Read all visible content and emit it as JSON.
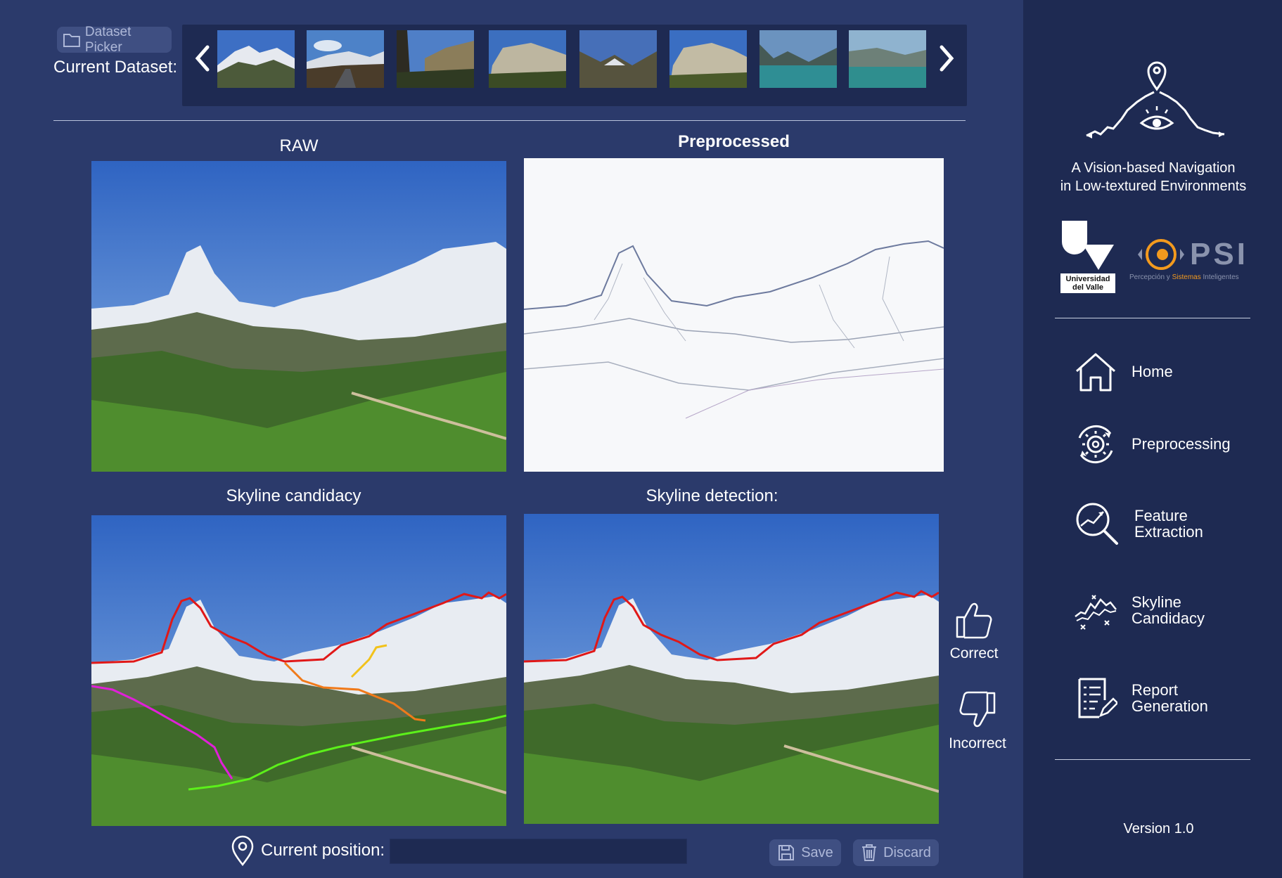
{
  "header": {
    "dataset_picker_label": "Dataset Picker",
    "current_dataset_label": "Current Dataset:",
    "folder_icon": "folder-icon",
    "prev_icon": "chevron-left-icon",
    "next_icon": "chevron-right-icon",
    "thumbnails": [
      "mountain-snow",
      "mountain-road",
      "mountain-valley",
      "cliff-wall",
      "mountain-valley-2",
      "cliff-wall-2",
      "lake-1",
      "lake-2"
    ]
  },
  "panels": {
    "raw_title": "RAW",
    "preprocessed_title": "Preprocessed",
    "candidacy_title": "Skyline candidacy",
    "detection_title": "Skyline detection:"
  },
  "feedback": {
    "correct_label": "Correct",
    "incorrect_label": "Incorrect",
    "correct_icon": "thumbs-up-icon",
    "incorrect_icon": "thumbs-down-icon"
  },
  "footer": {
    "position_label": "Current position:",
    "position_value": "",
    "location_icon": "location-pin-icon",
    "save_label": "Save",
    "discard_label": "Discard",
    "save_icon": "floppy-disk-icon",
    "discard_icon": "trash-icon"
  },
  "sidebar": {
    "title_line1": "A Vision-based Navigation",
    "title_line2": "in Low-textured Environments",
    "univalle_line1": "Universidad",
    "univalle_line2": "del Valle",
    "psi_text": "PSI",
    "psi_tagline_a": "Percepción y ",
    "psi_tagline_b": "Sistemas",
    "psi_tagline_c": " Inteligentes",
    "nav": [
      {
        "label": "Home",
        "icon": "home-icon"
      },
      {
        "label": "Preprocessing",
        "icon": "gear-cycle-icon"
      },
      {
        "label1": "Feature",
        "label2": "Extraction",
        "icon": "magnifier-chart-icon"
      },
      {
        "label1": "Skyline",
        "label2": "Candidacy",
        "icon": "skyline-icon"
      },
      {
        "label1": "Report",
        "label2": "Generation",
        "icon": "report-icon"
      }
    ],
    "version": "Version 1.0"
  },
  "colors": {
    "main_bg": "#2b3a6b",
    "sidebar_bg": "#1e2a52",
    "button_bg": "#3f4f82",
    "skyline_red": "#e01818",
    "candidate_orange": "#f07a1a",
    "candidate_yellow": "#f2c21a",
    "candidate_magenta": "#e020d8",
    "candidate_green": "#5cf01a"
  }
}
